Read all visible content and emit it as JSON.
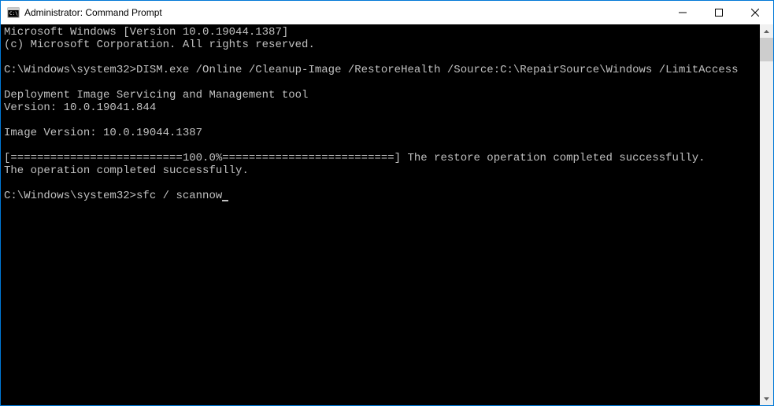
{
  "window": {
    "title": "Administrator: Command Prompt"
  },
  "console": {
    "lines": [
      "Microsoft Windows [Version 10.0.19044.1387]",
      "(c) Microsoft Corporation. All rights reserved.",
      "",
      "C:\\Windows\\system32>DISM.exe /Online /Cleanup-Image /RestoreHealth /Source:C:\\RepairSource\\Windows /LimitAccess",
      "",
      "Deployment Image Servicing and Management tool",
      "Version: 10.0.19041.844",
      "",
      "Image Version: 10.0.19044.1387",
      "",
      "[==========================100.0%==========================] The restore operation completed successfully.",
      "The operation completed successfully.",
      ""
    ],
    "prompt": "C:\\Windows\\system32>",
    "current_input": "sfc / scannow"
  }
}
